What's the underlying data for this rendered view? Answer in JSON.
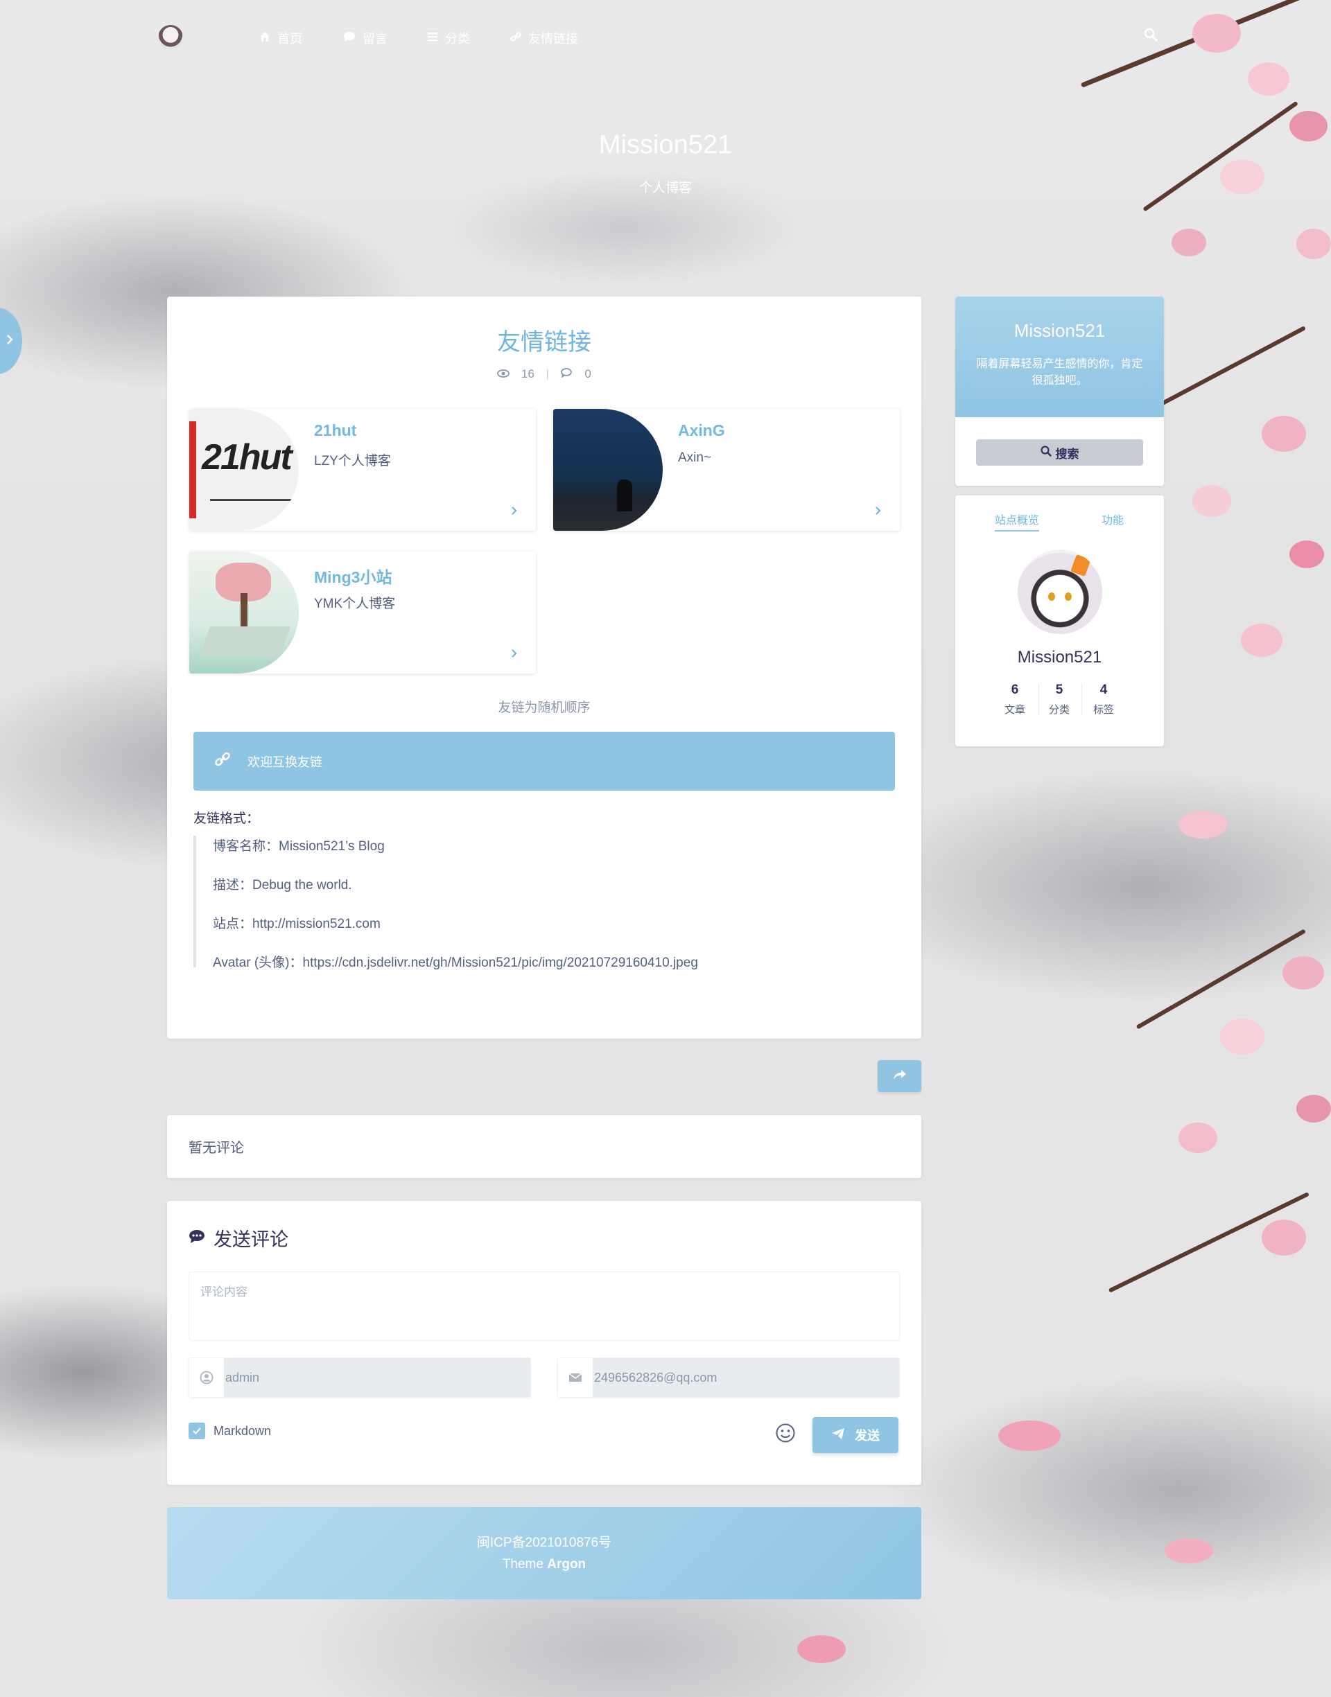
{
  "nav": {
    "items": [
      {
        "icon": "home-icon",
        "label": "首页"
      },
      {
        "icon": "comment-icon",
        "label": "留言"
      },
      {
        "icon": "list-icon",
        "label": "分类"
      },
      {
        "icon": "link-icon",
        "label": "友情链接"
      }
    ]
  },
  "banner": {
    "title": "Mission521",
    "subtitle": "个人博客"
  },
  "page": {
    "title": "友情链接",
    "views": "16",
    "comments": "0"
  },
  "links": [
    {
      "name": "21hut",
      "desc": "LZY个人博客",
      "avatar_text": "21hut"
    },
    {
      "name": "AxinG",
      "desc": "Axin~"
    },
    {
      "name": "Ming3小站",
      "desc": "YMK个人博客"
    }
  ],
  "content": {
    "random_note": "友链为随机顺序",
    "alert": "欢迎互换友链",
    "format_label": "友链格式：",
    "format_lines": [
      "博客名称：Mission521’s Blog",
      "描述：Debug the world.",
      "站点：http://mission521.com",
      "Avatar (头像)：https://cdn.jsdelivr.net/gh/Mission521/pic/img/20210729160410.jpeg"
    ]
  },
  "comments": {
    "empty": "暂无评论",
    "form_title": "发送评论",
    "content_placeholder": "评论内容",
    "name_value": "admin",
    "email_value": "2496562826@qq.com",
    "markdown_label": "Markdown",
    "send_label": "发送"
  },
  "footer": {
    "icp": "闽ICP备2021010876号",
    "theme_prefix": "Theme",
    "theme_name": "Argon"
  },
  "sidebar": {
    "profile_name": "Mission521",
    "profile_quote": "隔着屏幕轻易产生感情的你，肯定很孤独吧。",
    "search_label": "搜索",
    "tabs": [
      "站点概览",
      "功能"
    ],
    "author": "Mission521",
    "stats": [
      {
        "value": "6",
        "label": "文章"
      },
      {
        "value": "5",
        "label": "分类"
      },
      {
        "value": "4",
        "label": "标签"
      }
    ]
  },
  "colors": {
    "accent": "#8fc5e3",
    "title_blue": "#6fb6df",
    "text": "#525f7f",
    "heading": "#32325d"
  }
}
